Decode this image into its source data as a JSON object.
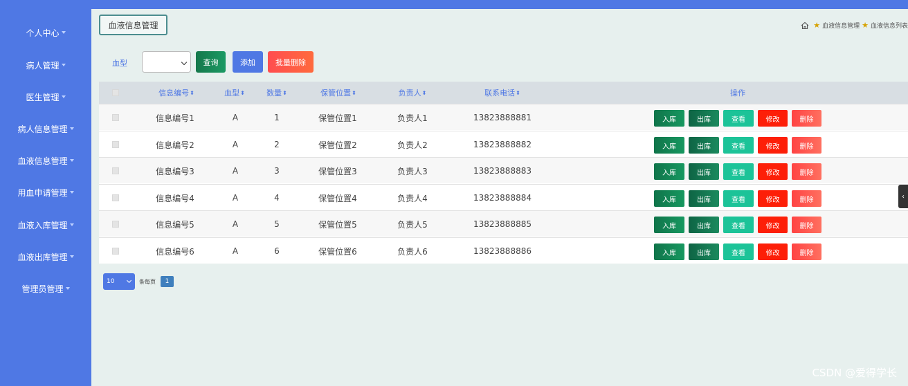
{
  "sidebar": {
    "items": [
      {
        "label": "个人中心"
      },
      {
        "label": "病人管理"
      },
      {
        "label": "医生管理"
      },
      {
        "label": "病人信息管理"
      },
      {
        "label": "血液信息管理"
      },
      {
        "label": "用血申请管理"
      },
      {
        "label": "血液入库管理"
      },
      {
        "label": "血液出库管理"
      },
      {
        "label": "管理员管理"
      }
    ]
  },
  "page": {
    "tab_title": "血液信息管理",
    "breadcrumb": [
      "血液信息管理",
      "血液信息列表"
    ]
  },
  "filter": {
    "label": "血型",
    "select_value": "",
    "query_label": "查询",
    "add_label": "添加",
    "batch_delete_label": "批量删除"
  },
  "table": {
    "columns": [
      "信息编号",
      "血型",
      "数量",
      "保管位置",
      "负责人",
      "联系电话",
      "操作"
    ],
    "sort_icon": "⬍",
    "rows": [
      {
        "id": "信息编号1",
        "type": "A",
        "qty": "1",
        "location": "保管位置1",
        "person": "负责人1",
        "phone": "13823888881"
      },
      {
        "id": "信息编号2",
        "type": "A",
        "qty": "2",
        "location": "保管位置2",
        "person": "负责人2",
        "phone": "13823888882"
      },
      {
        "id": "信息编号3",
        "type": "A",
        "qty": "3",
        "location": "保管位置3",
        "person": "负责人3",
        "phone": "13823888883"
      },
      {
        "id": "信息编号4",
        "type": "A",
        "qty": "4",
        "location": "保管位置4",
        "person": "负责人4",
        "phone": "13823888884"
      },
      {
        "id": "信息编号5",
        "type": "A",
        "qty": "5",
        "location": "保管位置5",
        "person": "负责人5",
        "phone": "13823888885"
      },
      {
        "id": "信息编号6",
        "type": "A",
        "qty": "6",
        "location": "保管位置6",
        "person": "负责人6",
        "phone": "13823888886"
      }
    ],
    "actions": {
      "in": "入库",
      "out": "出库",
      "view": "查看",
      "edit": "修改",
      "delete": "删除"
    }
  },
  "pagination": {
    "page_size": "10",
    "per_page_label": "条每页",
    "current_page": "1"
  },
  "watermark": "CSDN @爱得学长",
  "colors": {
    "sidebar": "#4f78e4",
    "background": "#e7f0ee"
  }
}
